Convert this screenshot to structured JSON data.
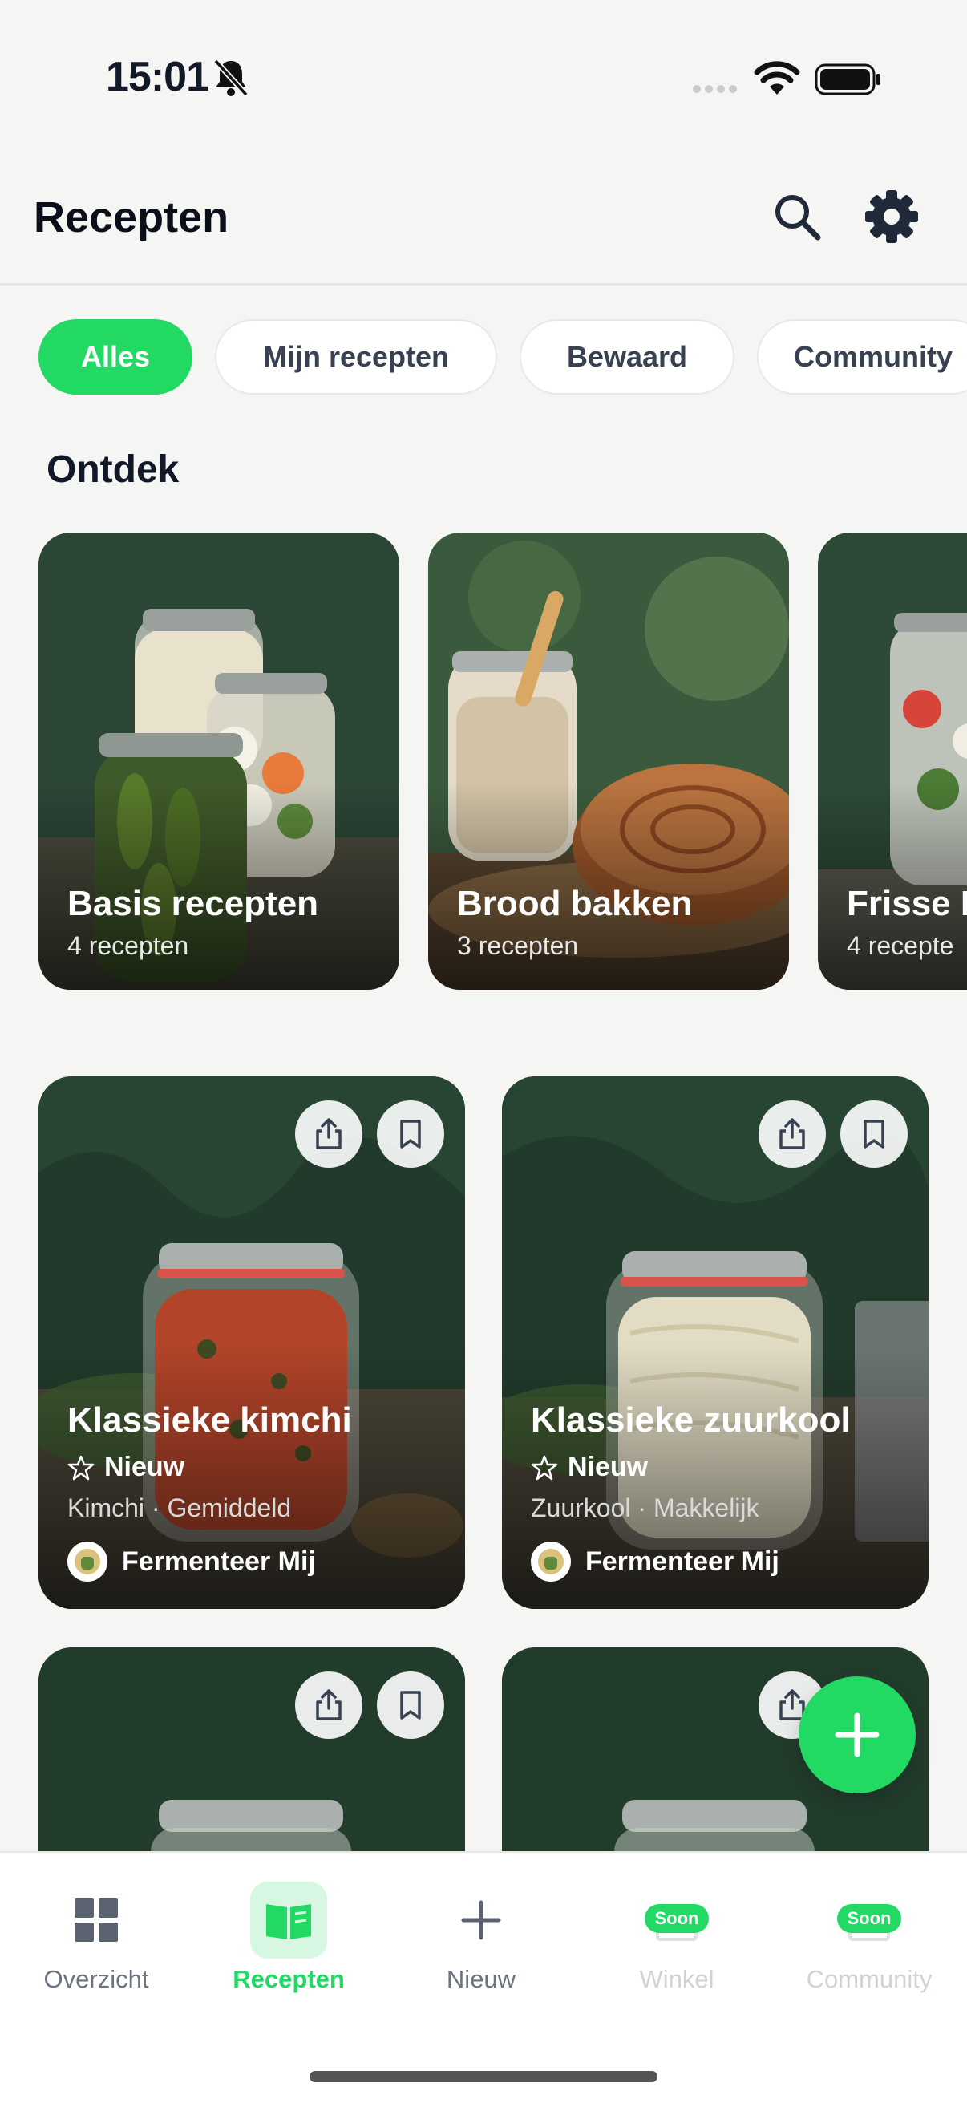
{
  "status": {
    "time": "15:01"
  },
  "header": {
    "title": "Recepten"
  },
  "filters": [
    {
      "label": "Alles",
      "active": true
    },
    {
      "label": "Mijn recepten",
      "active": false
    },
    {
      "label": "Bewaard",
      "active": false
    },
    {
      "label": "Community",
      "active": false
    }
  ],
  "discover": {
    "title": "Ontdek",
    "cards": [
      {
        "title": "Basis recepten",
        "count": "4 recepten"
      },
      {
        "title": "Brood bakken",
        "count": "3 recepten"
      },
      {
        "title": "Frisse Fermen",
        "count": "4 recepte"
      }
    ]
  },
  "recipes": [
    {
      "title": "Klassieke kimchi",
      "badge": "Nieuw",
      "meta": "Kimchi · Gemiddeld",
      "author": "Fermenteer Mij"
    },
    {
      "title": "Klassieke zuurkool",
      "badge": "Nieuw",
      "meta": "Zuurkool · Makkelijk",
      "author": "Fermenteer Mij"
    }
  ],
  "tabs": [
    {
      "label": "Overzicht",
      "icon": "grid-icon"
    },
    {
      "label": "Recepten",
      "icon": "book-icon"
    },
    {
      "label": "Nieuw",
      "icon": "plus-icon"
    },
    {
      "label": "Winkel",
      "icon": "shop-icon",
      "badge": "Soon"
    },
    {
      "label": "Community",
      "icon": "community-icon",
      "badge": "Soon"
    }
  ],
  "colors": {
    "accent": "#22d964",
    "background": "#f5f6f4"
  }
}
